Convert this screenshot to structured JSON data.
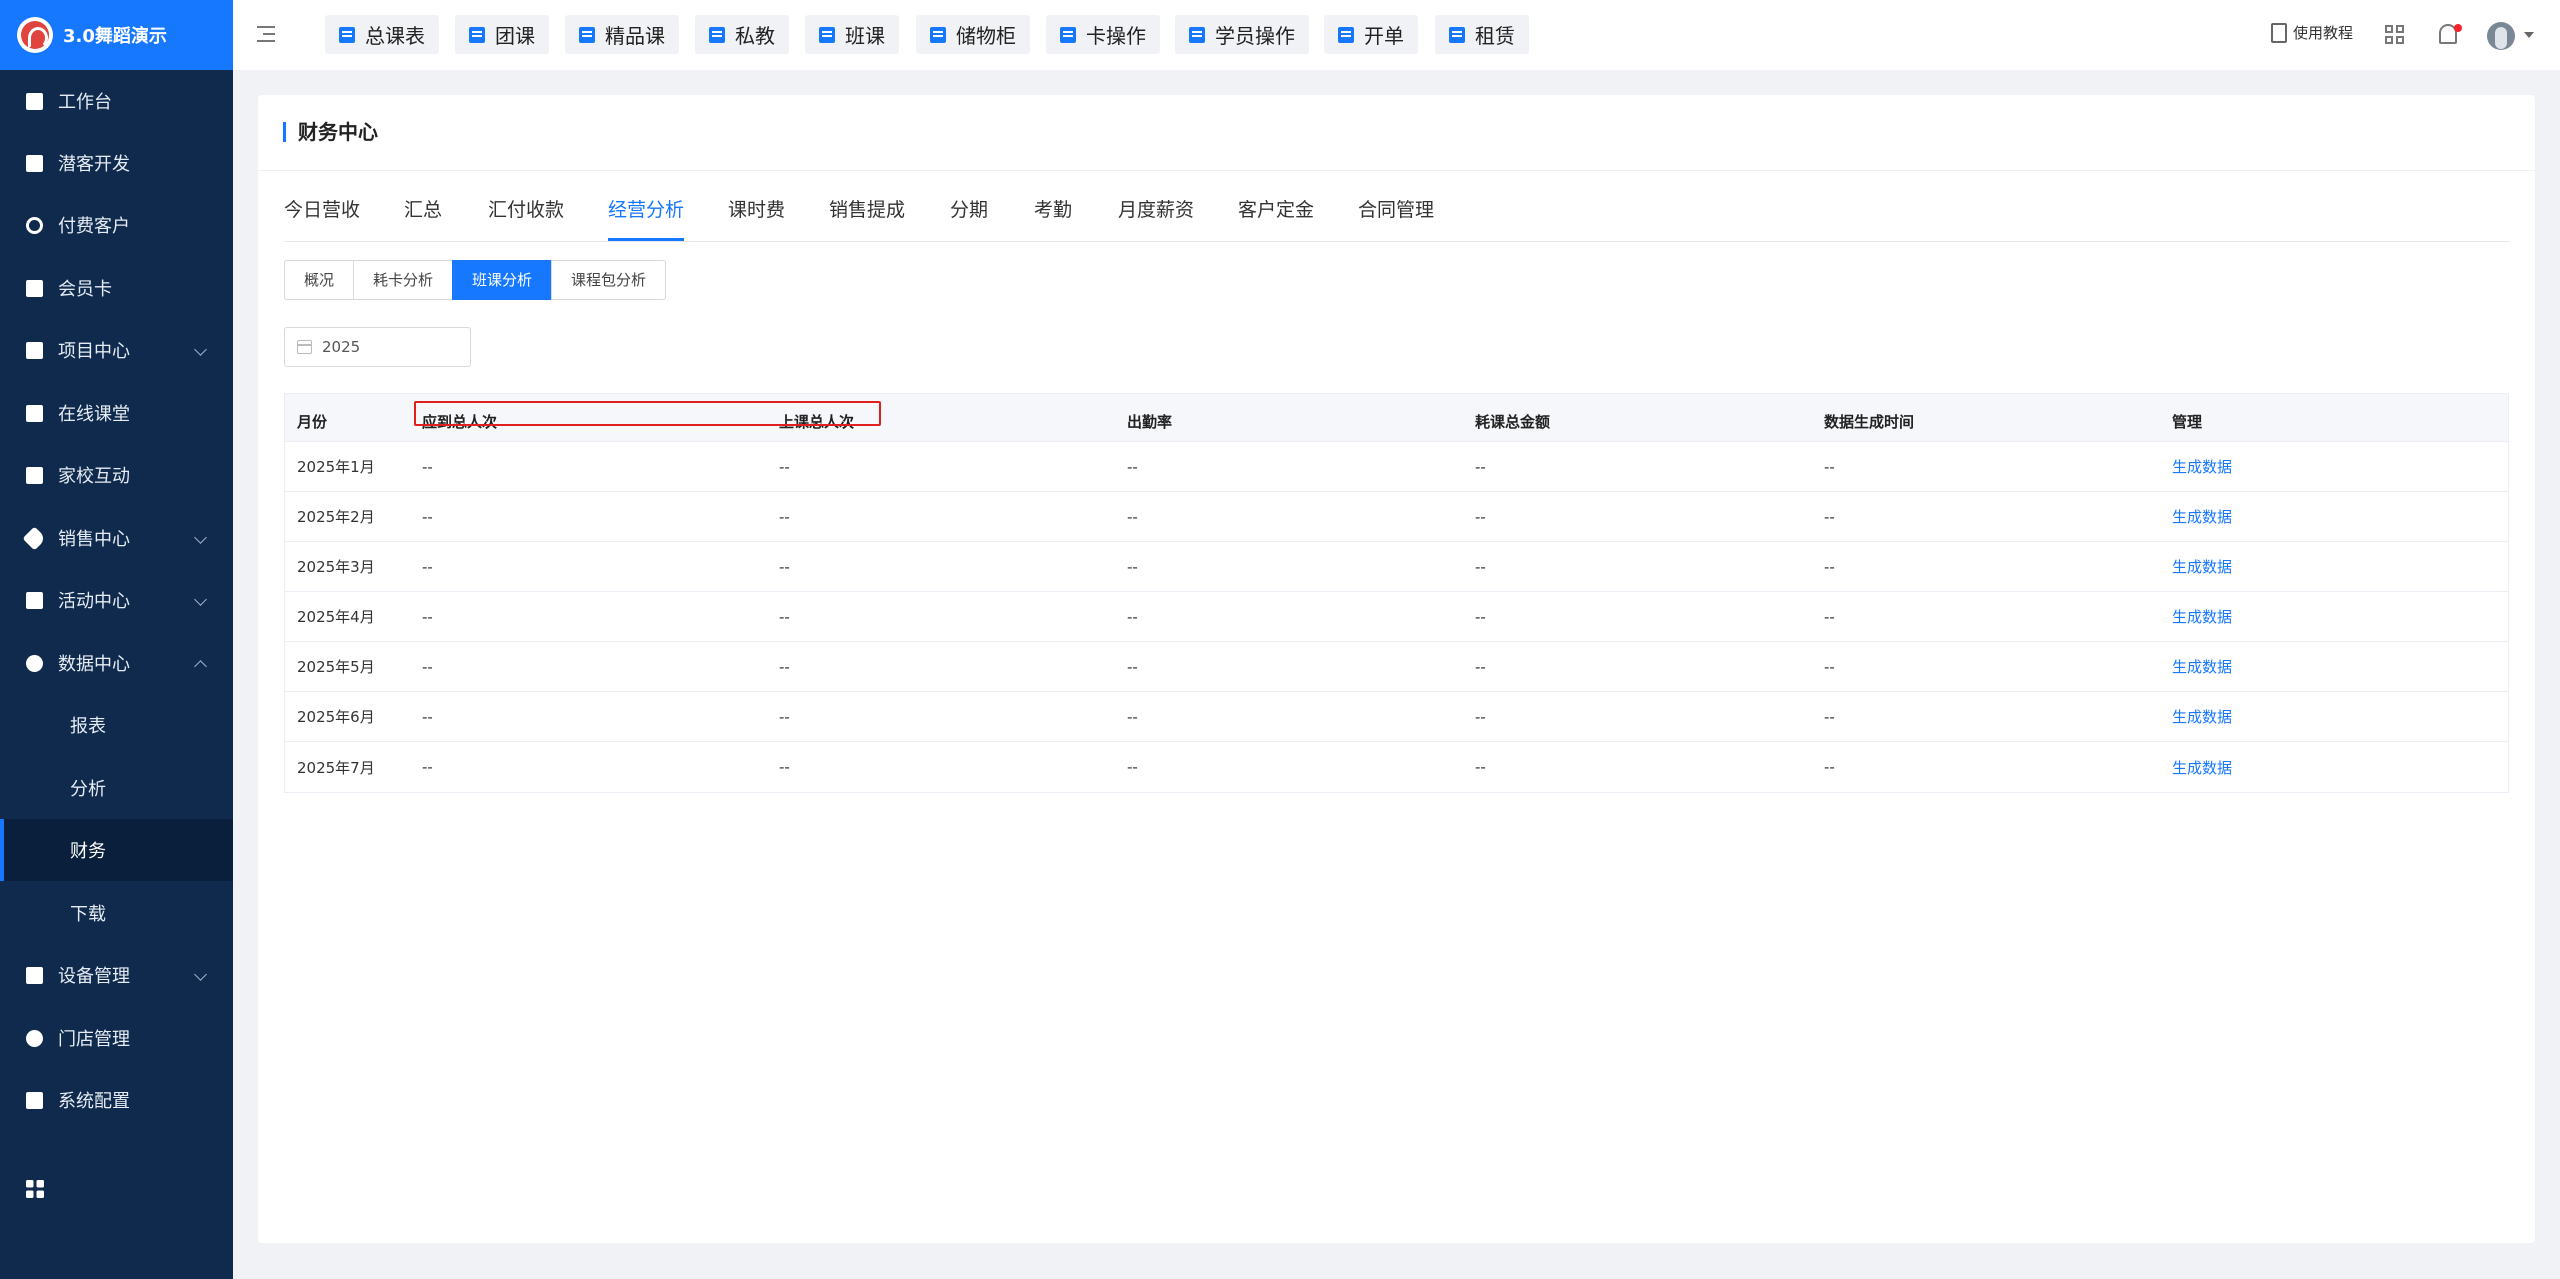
{
  "brand": {
    "name": "3.0舞蹈演示"
  },
  "sidebar": {
    "items": [
      {
        "label": "工作台",
        "icon": "image-icon"
      },
      {
        "label": "潜客开发",
        "icon": "id-card-icon"
      },
      {
        "label": "付费客户",
        "icon": "users-icon"
      },
      {
        "label": "会员卡",
        "icon": "card-icon"
      },
      {
        "label": "项目中心",
        "icon": "list-icon"
      },
      {
        "label": "在线课堂",
        "icon": "briefcase-icon"
      },
      {
        "label": "家校互动",
        "icon": "contact-icon"
      },
      {
        "label": "销售中心",
        "icon": "tag-icon"
      },
      {
        "label": "活动中心",
        "icon": "portrait-icon"
      },
      {
        "label": "数据中心",
        "icon": "pie-chart-icon"
      }
    ],
    "data_sub": [
      "报表",
      "分析",
      "财务",
      "下载"
    ],
    "items_after": [
      {
        "label": "设备管理",
        "icon": "devices-icon"
      },
      {
        "label": "门店管理",
        "icon": "store-icon"
      },
      {
        "label": "系统配置",
        "icon": "settings-icon"
      }
    ]
  },
  "topnav": [
    "总课表",
    "团课",
    "精品课",
    "私教",
    "班课",
    "储物柜",
    "卡操作",
    "学员操作",
    "开单",
    "租赁"
  ],
  "header": {
    "tutorial": "使用教程"
  },
  "page": {
    "title": "财务中心"
  },
  "tabs": [
    "今日营收",
    "汇总",
    "汇付收款",
    "经营分析",
    "课时费",
    "销售提成",
    "分期",
    "考勤",
    "月度薪资",
    "客户定金",
    "合同管理"
  ],
  "active_tab": "经营分析",
  "subtabs": [
    "概况",
    "耗卡分析",
    "班课分析",
    "课程包分析"
  ],
  "active_subtab": "班课分析",
  "year_picker": {
    "value": "2025"
  },
  "table": {
    "columns": [
      "月份",
      "应到总人次",
      "上课总人次",
      "出勤率",
      "耗课总金额",
      "数据生成时间",
      "管理"
    ],
    "rows": [
      {
        "month": "2025年1月",
        "expected": "--",
        "attended": "--",
        "rate": "--",
        "amount": "--",
        "time": "--",
        "action": "生成数据"
      },
      {
        "month": "2025年2月",
        "expected": "--",
        "attended": "--",
        "rate": "--",
        "amount": "--",
        "time": "--",
        "action": "生成数据"
      },
      {
        "month": "2025年3月",
        "expected": "--",
        "attended": "--",
        "rate": "--",
        "amount": "--",
        "time": "--",
        "action": "生成数据"
      },
      {
        "month": "2025年4月",
        "expected": "--",
        "attended": "--",
        "rate": "--",
        "amount": "--",
        "time": "--",
        "action": "生成数据"
      },
      {
        "month": "2025年5月",
        "expected": "--",
        "attended": "--",
        "rate": "--",
        "amount": "--",
        "time": "--",
        "action": "生成数据"
      },
      {
        "month": "2025年6月",
        "expected": "--",
        "attended": "--",
        "rate": "--",
        "amount": "--",
        "time": "--",
        "action": "生成数据"
      },
      {
        "month": "2025年7月",
        "expected": "--",
        "attended": "--",
        "rate": "--",
        "amount": "--",
        "time": "--",
        "action": "生成数据"
      }
    ]
  },
  "colors": {
    "primary": "#1677ff",
    "sidebar": "#0f2a4d",
    "highlight": "#e0201d"
  }
}
